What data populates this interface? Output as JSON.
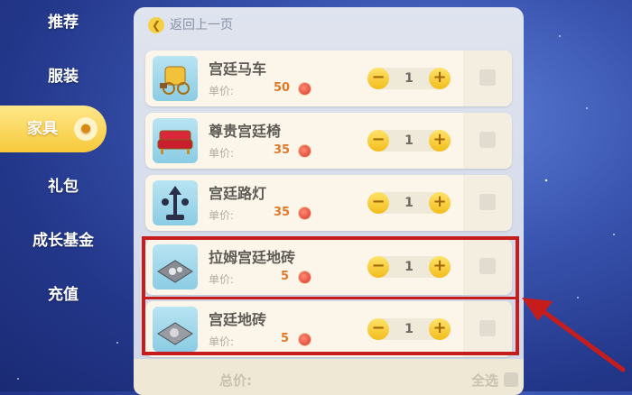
{
  "sidebar": {
    "items": [
      {
        "label": "推荐"
      },
      {
        "label": "服装"
      },
      {
        "label": "家具",
        "active": true
      },
      {
        "label": "礼包"
      },
      {
        "label": "成长基金"
      },
      {
        "label": "充值"
      }
    ]
  },
  "panel": {
    "back_label": "返回上一页",
    "unit_price_label": "单价:",
    "items": [
      {
        "name": "宫廷马车",
        "price": "50",
        "qty": "1",
        "thumb": "carriage"
      },
      {
        "name": "尊贵宫廷椅",
        "price": "35",
        "qty": "1",
        "thumb": "sofa"
      },
      {
        "name": "宫廷路灯",
        "price": "35",
        "qty": "1",
        "thumb": "lamp"
      },
      {
        "name": "拉姆宫廷地砖",
        "price": "5",
        "qty": "1",
        "thumb": "tile-lamu"
      },
      {
        "name": "宫廷地砖",
        "price": "5",
        "qty": "1",
        "thumb": "tile"
      }
    ]
  },
  "footer": {
    "total_label": "总价:",
    "select_all_label": "全选"
  },
  "colors": {
    "highlight": "#c71c1c",
    "accent_yellow": "#f6c93a",
    "price": "#e07a2a"
  }
}
